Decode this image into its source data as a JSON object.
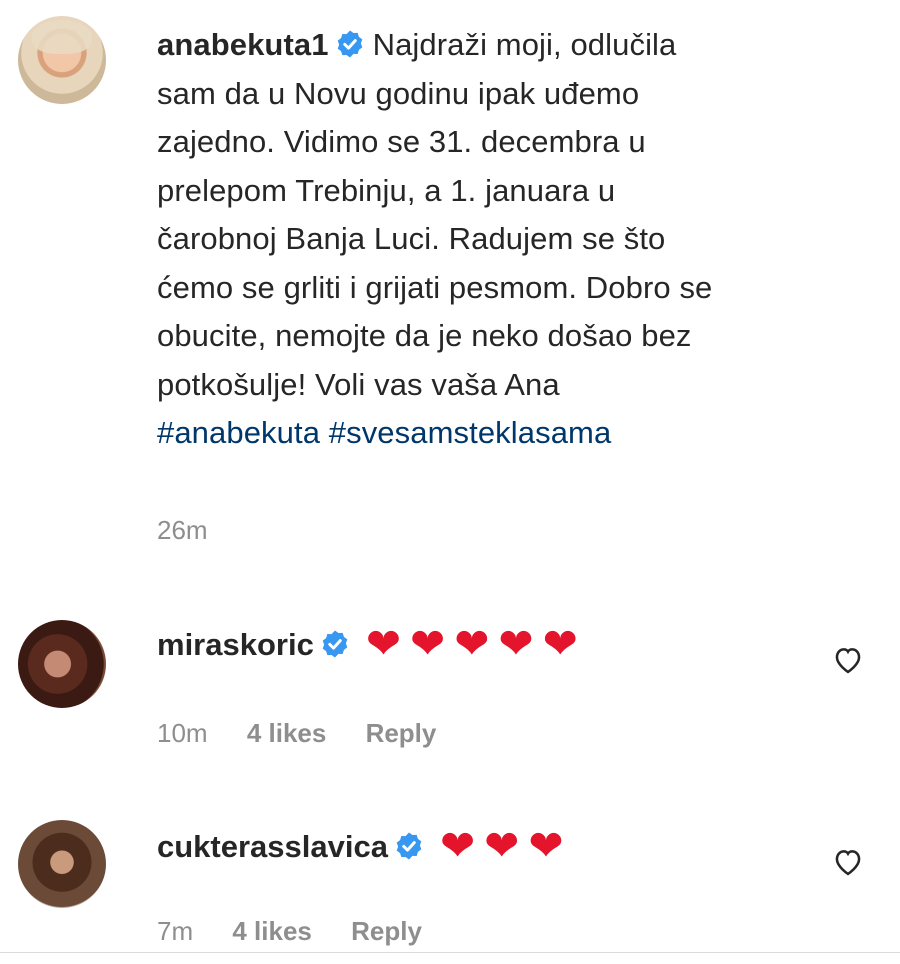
{
  "post": {
    "author": "anabekuta1",
    "caption_lines": [
      "Najdraži moji, odlučila",
      "sam da u Novu godinu ipak uđemo",
      "zajedno. Vidimo se 31. decembra u",
      "prelepom Trebinju, a 1. januara u",
      "čarobnoj Banja Luci. Radujem se što",
      "ćemo se grliti i grijati pesmom. Dobro se",
      "obucite, nemojte da je neko došao bez",
      "potkošulje! Voli vas vaša Ana"
    ],
    "hashtags": [
      "#anabekuta",
      "#svesamsteklasama"
    ],
    "time": "26m"
  },
  "comments": [
    {
      "username": "miraskoric",
      "text": "❤❤❤❤❤",
      "time": "10m",
      "likes": "4 likes",
      "reply": "Reply"
    },
    {
      "username": "cukterasslavica",
      "text": "❤❤❤",
      "time": "7m",
      "likes": "4 likes",
      "reply": "Reply"
    }
  ],
  "icons": {
    "verified": "verified-badge-icon",
    "like": "heart-outline-icon"
  },
  "colors": {
    "verified": "#3897f0",
    "hashtag": "#00376b",
    "meta": "#8e8e8e",
    "heart": "#e3142b"
  }
}
